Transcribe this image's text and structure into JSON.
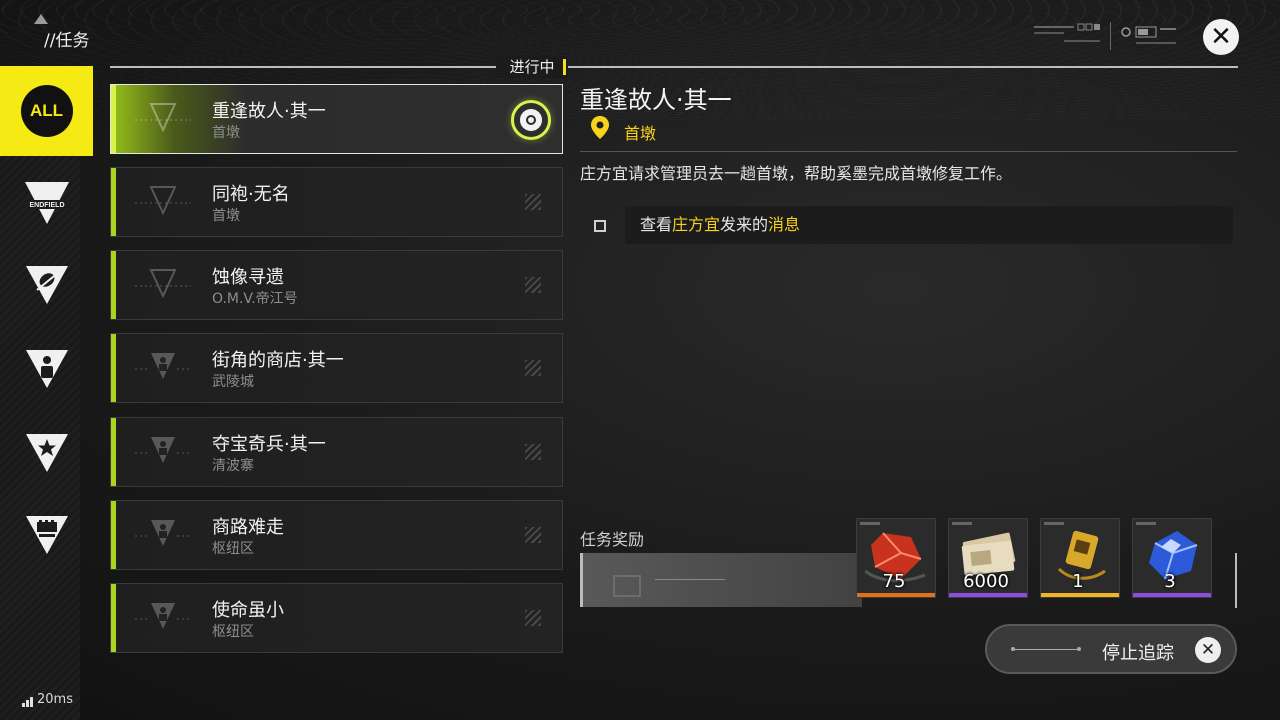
{
  "header": {
    "title": "//任务",
    "close_icon": "close-icon"
  },
  "status_tag": "进行中",
  "categories": [
    {
      "id": "all",
      "label": "ALL",
      "icon": "all-badge",
      "active": true
    },
    {
      "id": "endfield",
      "label": "ENDFIELD",
      "icon": "endfield-icon"
    },
    {
      "id": "side",
      "icon": "leaf-triangle-icon"
    },
    {
      "id": "person",
      "icon": "person-triangle-icon"
    },
    {
      "id": "star",
      "icon": "star-triangle-icon"
    },
    {
      "id": "factory",
      "icon": "factory-triangle-icon"
    }
  ],
  "quests": [
    {
      "name": "重逢故人·其一",
      "location": "首墩",
      "selected": true,
      "tracked": true
    },
    {
      "name": "同袍·无名",
      "location": "首墩"
    },
    {
      "name": "蚀像寻遗",
      "location": "O.M.V.帝江号"
    },
    {
      "name": "街角的商店·其一",
      "location": "武陵城"
    },
    {
      "name": "夺宝奇兵·其一",
      "location": "清波寨"
    },
    {
      "name": "商路难走",
      "location": "枢纽区"
    },
    {
      "name": "使命虽小",
      "location": "枢纽区"
    }
  ],
  "detail": {
    "title": "重逢故人·其一",
    "location": "首墩",
    "description": "庄方宜请求管理员去一趟首墩，帮助奚墨完成首墩修复工作。",
    "objective": {
      "prefix": "查看",
      "person": "庄方宜",
      "middle": "发来的",
      "item": "消息"
    }
  },
  "rewards": {
    "label": "任务奖励",
    "items": [
      {
        "icon": "red-crystal-icon",
        "count": "75",
        "rarity_color": "#e0721e"
      },
      {
        "icon": "banknote-icon",
        "count": "6000",
        "rarity_color": "#8a4fe0"
      },
      {
        "icon": "gold-chip-icon",
        "count": "1",
        "rarity_color": "#f0b424"
      },
      {
        "icon": "blue-crystal-icon",
        "count": "3",
        "rarity_color": "#8a4fe0"
      }
    ]
  },
  "stop_tracking": {
    "label": "停止追踪"
  },
  "network": {
    "ping": "20ms"
  },
  "colors": {
    "accent_yellow": "#f6ea14",
    "accent_green": "#a9d51e",
    "highlight_text": "#f5d21c"
  }
}
